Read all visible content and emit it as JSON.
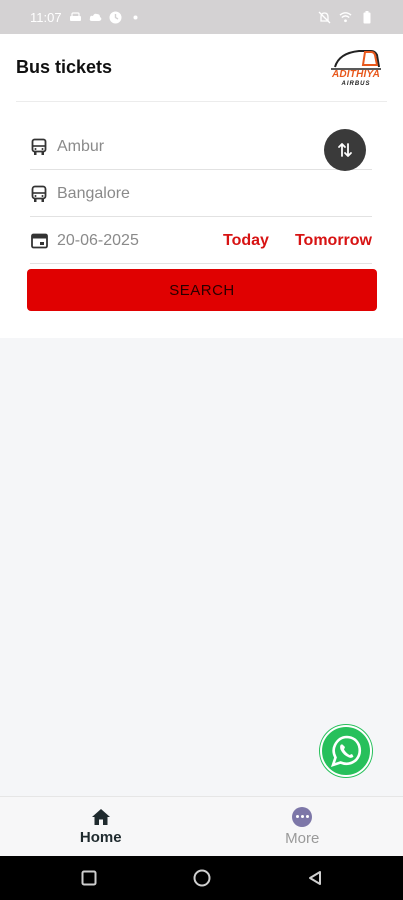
{
  "status_bar": {
    "time": "11:07",
    "icons_left": [
      "car-notification-icon",
      "cloud-sync-icon",
      "clock-icon",
      "dot-icon"
    ],
    "icons_right": [
      "bell-off-icon",
      "wifi-icon",
      "battery-icon"
    ]
  },
  "header": {
    "title": "Bus tickets",
    "logo_text": "ADITHIYA",
    "logo_subtext": "AIRBUS"
  },
  "search_form": {
    "from_value": "Ambur",
    "to_value": "Bangalore",
    "date_value": "20-06-2025",
    "today_label": "Today",
    "tomorrow_label": "Tomorrow",
    "search_label": "SEARCH"
  },
  "bottom_nav": {
    "items": [
      {
        "label": "Home",
        "icon": "home-icon",
        "active": true
      },
      {
        "label": "More",
        "icon": "more-icon",
        "active": false
      }
    ]
  },
  "colors": {
    "accent": "#e00101",
    "date_links": "#d71313",
    "whatsapp": "#27c05b",
    "swap_button": "#3a3a3a"
  }
}
